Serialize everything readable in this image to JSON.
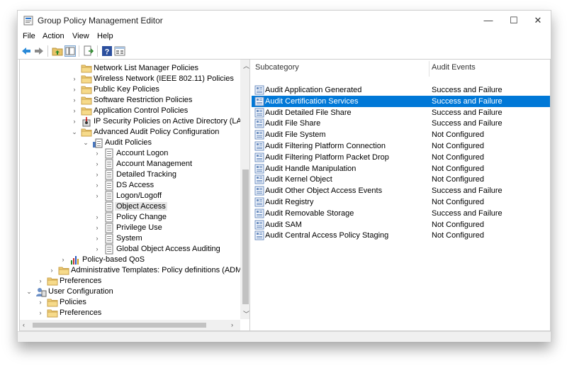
{
  "window": {
    "title": "Group Policy Management Editor",
    "minimize": "—",
    "maximize": "☐",
    "close": "✕"
  },
  "menu": [
    "File",
    "Action",
    "View",
    "Help"
  ],
  "colors": {
    "selection": "#0078d7",
    "folder": "#e8c46a",
    "accent": "#1e73c8"
  },
  "tree": [
    {
      "label": "Network List Manager Policies",
      "icon": "folder-icon",
      "indent": 4,
      "arrow": ""
    },
    {
      "label": "Wireless Network (IEEE 802.11) Policies",
      "icon": "folder-icon",
      "indent": 4,
      "arrow": "›"
    },
    {
      "label": "Public Key Policies",
      "icon": "folder-icon",
      "indent": 4,
      "arrow": "›"
    },
    {
      "label": "Software Restriction Policies",
      "icon": "folder-icon",
      "indent": 4,
      "arrow": "›"
    },
    {
      "label": "Application Control Policies",
      "icon": "folder-icon",
      "indent": 4,
      "arrow": "›"
    },
    {
      "label": "IP Security Policies on Active Directory (LAB.LOCAL)",
      "icon": "ipsec-icon",
      "indent": 4,
      "arrow": "›"
    },
    {
      "label": "Advanced Audit Policy Configuration",
      "icon": "folder-icon",
      "indent": 4,
      "arrow": "⌄"
    },
    {
      "label": "Audit Policies",
      "icon": "audit-policies-icon",
      "indent": 5,
      "arrow": "⌄"
    },
    {
      "label": "Account Logon",
      "icon": "policy-page-icon",
      "indent": 6,
      "arrow": "›"
    },
    {
      "label": "Account Management",
      "icon": "policy-page-icon",
      "indent": 6,
      "arrow": "›"
    },
    {
      "label": "Detailed Tracking",
      "icon": "policy-page-icon",
      "indent": 6,
      "arrow": "›"
    },
    {
      "label": "DS Access",
      "icon": "policy-page-icon",
      "indent": 6,
      "arrow": "›"
    },
    {
      "label": "Logon/Logoff",
      "icon": "policy-page-icon",
      "indent": 6,
      "arrow": "›"
    },
    {
      "label": "Object Access",
      "icon": "policy-page-icon",
      "indent": 6,
      "arrow": "",
      "selected": true
    },
    {
      "label": "Policy Change",
      "icon": "policy-page-icon",
      "indent": 6,
      "arrow": "›"
    },
    {
      "label": "Privilege Use",
      "icon": "policy-page-icon",
      "indent": 6,
      "arrow": "›"
    },
    {
      "label": "System",
      "icon": "policy-page-icon",
      "indent": 6,
      "arrow": "›"
    },
    {
      "label": "Global Object Access Auditing",
      "icon": "policy-page-icon",
      "indent": 6,
      "arrow": "›"
    },
    {
      "label": "Policy-based QoS",
      "icon": "qos-chart-icon",
      "indent": 3,
      "arrow": "›"
    },
    {
      "label": "Administrative Templates: Policy definitions (ADMX files)",
      "icon": "folder-icon",
      "indent": 2,
      "arrow": "›"
    },
    {
      "label": "Preferences",
      "icon": "folder-icon",
      "indent": 1,
      "arrow": "›"
    },
    {
      "label": "User Configuration",
      "icon": "user-config-icon",
      "indent": 0,
      "arrow": "⌄"
    },
    {
      "label": "Policies",
      "icon": "folder-icon",
      "indent": 1,
      "arrow": "›"
    },
    {
      "label": "Preferences",
      "icon": "folder-icon",
      "indent": 1,
      "arrow": "›"
    }
  ],
  "list": {
    "columns": [
      "Subcategory",
      "Audit Events"
    ],
    "rows": [
      {
        "name": "Audit Application Generated",
        "status": "Success and Failure"
      },
      {
        "name": "Audit Certification Services",
        "status": "Success and Failure",
        "selected": true
      },
      {
        "name": "Audit Detailed File Share",
        "status": "Success and Failure"
      },
      {
        "name": "Audit File Share",
        "status": "Success and Failure"
      },
      {
        "name": "Audit File System",
        "status": "Not Configured"
      },
      {
        "name": "Audit Filtering Platform Connection",
        "status": "Not Configured"
      },
      {
        "name": "Audit Filtering Platform Packet Drop",
        "status": "Not Configured"
      },
      {
        "name": "Audit Handle Manipulation",
        "status": "Not Configured"
      },
      {
        "name": "Audit Kernel Object",
        "status": "Not Configured"
      },
      {
        "name": "Audit Other Object Access Events",
        "status": "Success and Failure"
      },
      {
        "name": "Audit Registry",
        "status": "Not Configured"
      },
      {
        "name": "Audit Removable Storage",
        "status": "Success and Failure"
      },
      {
        "name": "Audit SAM",
        "status": "Not Configured"
      },
      {
        "name": "Audit Central Access Policy Staging",
        "status": "Not Configured"
      }
    ]
  }
}
